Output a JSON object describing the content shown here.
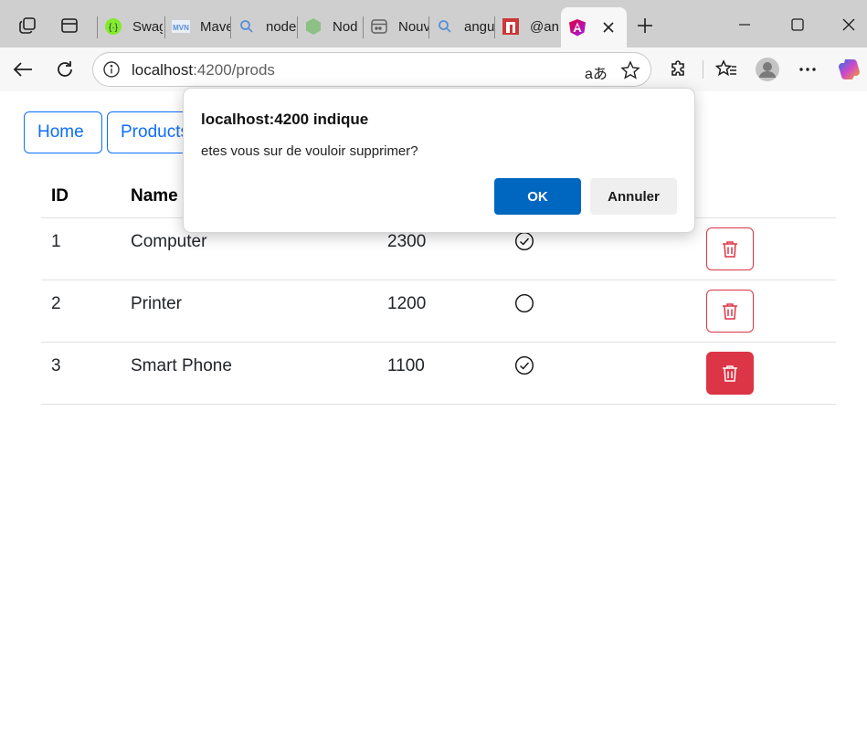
{
  "browser": {
    "tabs": [
      {
        "title": "Swag",
        "icon": "swagger-icon",
        "color": "#85ea2d"
      },
      {
        "title": "Mave",
        "icon": "maven-icon",
        "color": "#5a8fd6"
      },
      {
        "title": "node",
        "icon": "search-icon",
        "color": "#5a8fd6"
      },
      {
        "title": "Nod",
        "icon": "nodejs-icon",
        "color": "#6cab5c"
      },
      {
        "title": "Nouv",
        "icon": "new-tab-icon",
        "color": "#606060"
      },
      {
        "title": "angu",
        "icon": "search-icon",
        "color": "#5a8fd6"
      },
      {
        "title": "@an",
        "icon": "npm-icon",
        "color": "#cb3837"
      }
    ],
    "active_tab_icon": "angular-icon",
    "url_host": "localhost",
    "url_path": ":4200/prods",
    "translate_glyph": "aあ"
  },
  "nav": {
    "home": "Home",
    "products": "Products"
  },
  "table": {
    "headers": {
      "id": "ID",
      "name": "Name"
    },
    "rows": [
      {
        "id": "1",
        "name": "Computer",
        "price": "2300",
        "selected": true
      },
      {
        "id": "2",
        "name": "Printer",
        "price": "1200",
        "selected": false
      },
      {
        "id": "3",
        "name": "Smart Phone",
        "price": "1100",
        "selected": true
      }
    ],
    "danger_color": "#dc3545",
    "primary_color": "#0d6efd"
  },
  "dialog": {
    "title": "localhost:4200 indique",
    "message": "etes vous sur de vouloir supprimer?",
    "ok_label": "OK",
    "cancel_label": "Annuler",
    "ok_color": "#0067c0"
  }
}
